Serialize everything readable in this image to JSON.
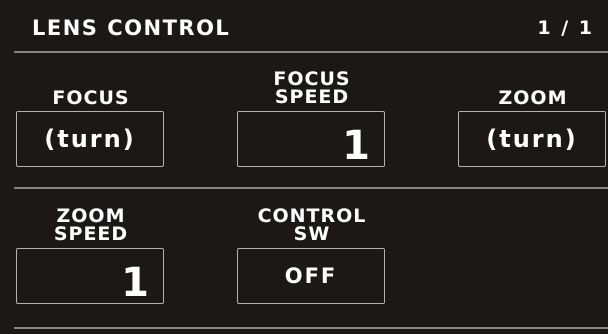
{
  "header": {
    "title": "LENS CONTROL",
    "page": "1 / 1"
  },
  "row1": {
    "focus": {
      "label_lines": [
        "FOCUS"
      ],
      "value": "(turn)"
    },
    "focus_speed": {
      "label_lines": [
        "FOCUS",
        "SPEED"
      ],
      "value": "1"
    },
    "zoom": {
      "label_lines": [
        "ZOOM"
      ],
      "value": "(turn)"
    }
  },
  "row2": {
    "zoom_speed": {
      "label_lines": [
        "ZOOM",
        "SPEED"
      ],
      "value": "1"
    },
    "control_sw": {
      "label_lines": [
        "CONTROL",
        "SW"
      ],
      "value": "OFF"
    }
  }
}
